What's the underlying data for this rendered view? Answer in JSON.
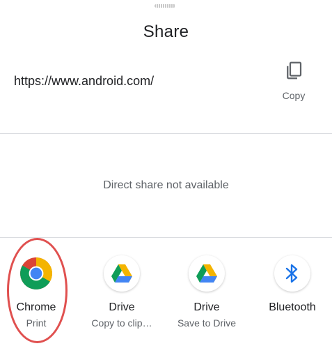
{
  "sheet": {
    "title": "Share",
    "url": "https://www.android.com/",
    "copy_label": "Copy",
    "direct_share_text": "Direct share not available"
  },
  "targets": [
    {
      "name": "Chrome",
      "sub": "Print",
      "icon": "chrome-icon"
    },
    {
      "name": "Drive",
      "sub": "Copy to clip…",
      "icon": "google-drive-icon"
    },
    {
      "name": "Drive",
      "sub": "Save to Drive",
      "icon": "google-drive-icon"
    },
    {
      "name": "Bluetooth",
      "sub": "",
      "icon": "bluetooth-icon"
    }
  ],
  "colors": {
    "highlight": "#e0504f",
    "divider": "#dadce0",
    "bluetooth": "#1a73e8"
  }
}
